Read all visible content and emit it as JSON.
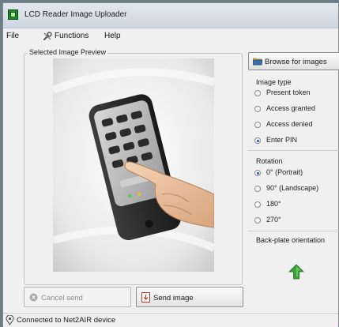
{
  "window": {
    "title": "LCD Reader Image Uploader"
  },
  "menu": {
    "file": "File",
    "functions": "Functions",
    "help": "Help"
  },
  "preview": {
    "label": "Selected Image Preview"
  },
  "buttons": {
    "browse": "Browse for images",
    "cancel_send": "Cancel send",
    "send_image": "Send image"
  },
  "image_type": {
    "title": "Image type",
    "options": [
      "Present token",
      "Access granted",
      "Access denied",
      "Enter PIN"
    ],
    "selected": "Enter PIN"
  },
  "rotation": {
    "title": "Rotation",
    "options": [
      "0° (Portrait)",
      "90° (Landscape)",
      "180°",
      "270°"
    ],
    "selected": "0° (Portrait)"
  },
  "backplate": {
    "title": "Back-plate orientation"
  },
  "status": {
    "text": "Connected to Net2AIR device"
  },
  "colors": {
    "accent_green": "#3aa23a",
    "radio_selected": "#1a56c4"
  }
}
